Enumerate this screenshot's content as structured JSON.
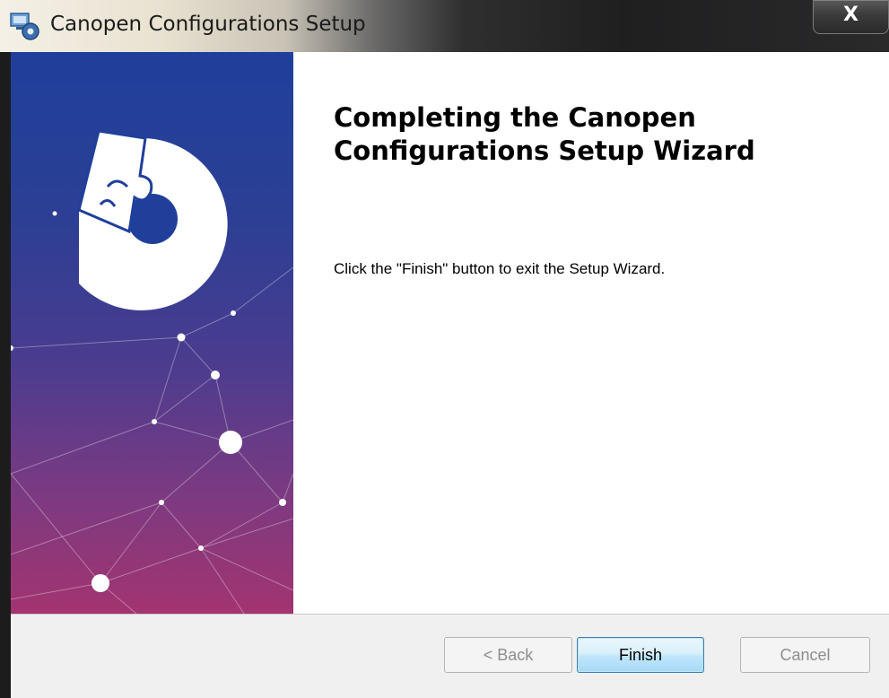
{
  "window": {
    "title": "Canopen Configurations Setup",
    "close_label": "X"
  },
  "wizard": {
    "heading": "Completing the Canopen\nConfigurations Setup Wizard",
    "message": "Click the \"Finish\" button to exit the Setup Wizard."
  },
  "buttons": {
    "back": "< Back",
    "finish": "Finish",
    "cancel": "Cancel"
  },
  "colors": {
    "banner_top": "#1f3f9b",
    "banner_bottom": "#a33470",
    "finish_border": "#3c7fb1"
  },
  "icons": {
    "app": "setup-icon",
    "banner": "puzzle-logo-icon"
  }
}
